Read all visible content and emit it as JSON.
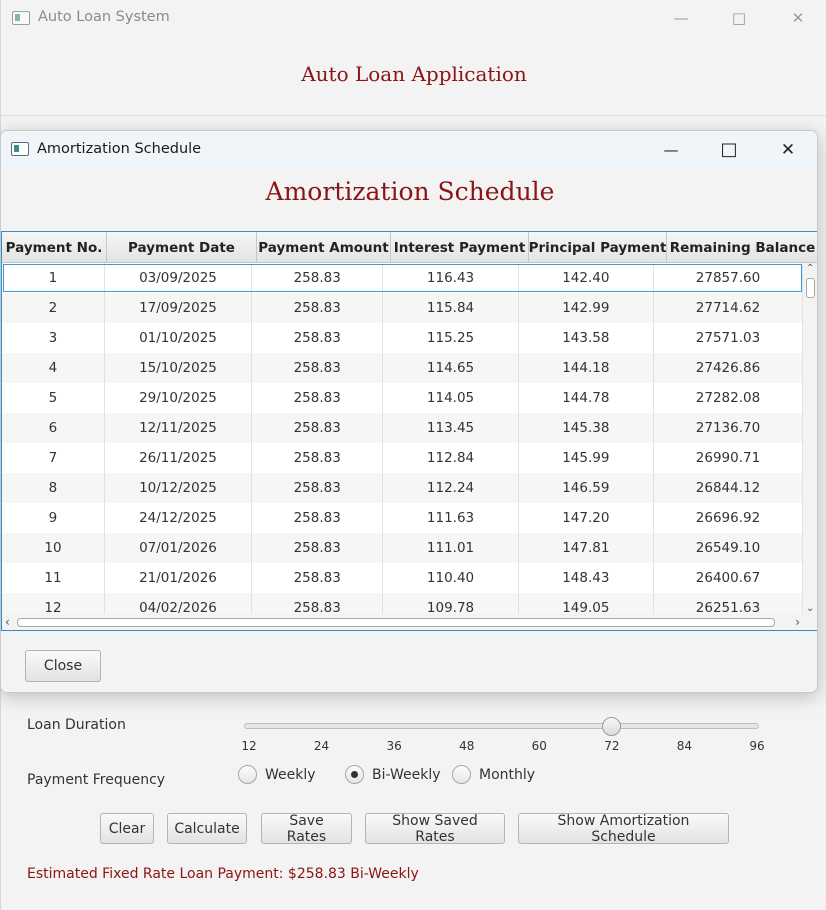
{
  "main_window": {
    "title": "Auto Loan System",
    "heading": "Auto Loan Application",
    "loan_duration": {
      "label": "Loan Duration",
      "ticks": [
        "12",
        "24",
        "36",
        "48",
        "60",
        "72",
        "84",
        "96"
      ],
      "value": 72,
      "min": 12,
      "max": 96
    },
    "payment_frequency": {
      "label": "Payment Frequency",
      "options": [
        "Weekly",
        "Bi-Weekly",
        "Monthly"
      ],
      "selected": "Bi-Weekly"
    },
    "buttons": {
      "clear": "Clear",
      "calculate": "Calculate",
      "save_rates": "Save Rates",
      "show_saved_rates": "Show Saved Rates",
      "show_amortization": "Show Amortization Schedule"
    },
    "result": "Estimated Fixed Rate Loan Payment: $258.83 Bi-Weekly"
  },
  "dialog": {
    "title": "Amortization Schedule",
    "heading": "Amortization Schedule",
    "columns": [
      "Payment No.",
      "Payment Date",
      "Payment Amount",
      "Interest Payment",
      "Principal Payment",
      "Remaining Balance"
    ],
    "rows": [
      [
        "1",
        "03/09/2025",
        "258.83",
        "116.43",
        "142.40",
        "27857.60"
      ],
      [
        "2",
        "17/09/2025",
        "258.83",
        "115.84",
        "142.99",
        "27714.62"
      ],
      [
        "3",
        "01/10/2025",
        "258.83",
        "115.25",
        "143.58",
        "27571.03"
      ],
      [
        "4",
        "15/10/2025",
        "258.83",
        "114.65",
        "144.18",
        "27426.86"
      ],
      [
        "5",
        "29/10/2025",
        "258.83",
        "114.05",
        "144.78",
        "27282.08"
      ],
      [
        "6",
        "12/11/2025",
        "258.83",
        "113.45",
        "145.38",
        "27136.70"
      ],
      [
        "7",
        "26/11/2025",
        "258.83",
        "112.84",
        "145.99",
        "26990.71"
      ],
      [
        "8",
        "10/12/2025",
        "258.83",
        "112.24",
        "146.59",
        "26844.12"
      ],
      [
        "9",
        "24/12/2025",
        "258.83",
        "111.63",
        "147.20",
        "26696.92"
      ],
      [
        "10",
        "07/01/2026",
        "258.83",
        "111.01",
        "147.81",
        "26549.10"
      ],
      [
        "11",
        "21/01/2026",
        "258.83",
        "110.40",
        "148.43",
        "26400.67"
      ],
      [
        "12",
        "04/02/2026",
        "258.83",
        "109.78",
        "149.05",
        "26251.63"
      ]
    ],
    "close_label": "Close"
  }
}
